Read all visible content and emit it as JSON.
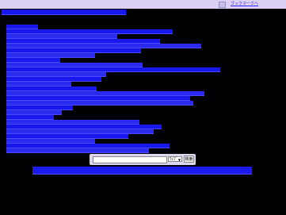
{
  "header": {
    "bookmark_link": "ブックマークへ",
    "bookmark_icon": "bookmark-icon"
  },
  "search": {
    "input_value": "",
    "select_value": "ｳｪﾌﾞ",
    "button_label": "検索"
  },
  "colors": {
    "background": "#000000",
    "topbar": "#dcd0f5",
    "link_highlight": "#1717ee",
    "link_text": "#2a2aff"
  }
}
